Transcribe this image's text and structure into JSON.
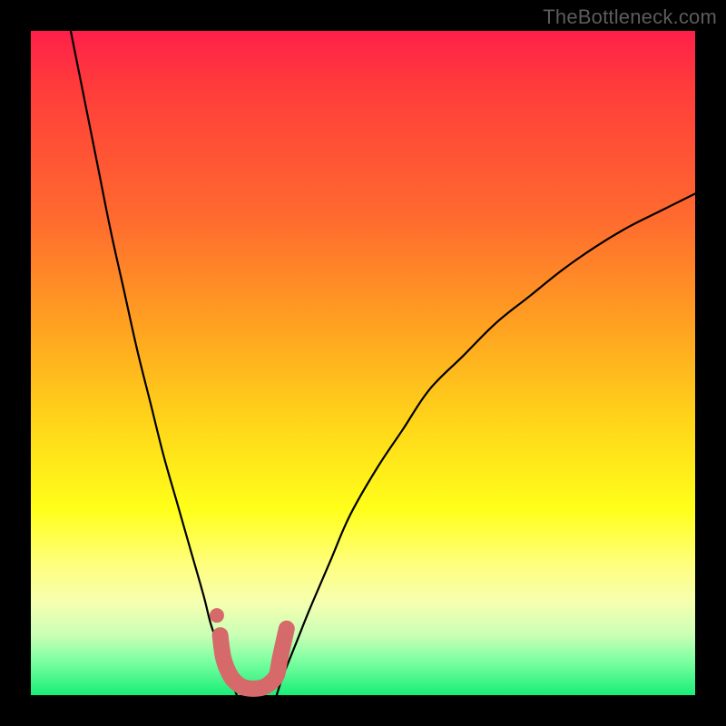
{
  "watermark": "TheBottleneck.com",
  "chart_data": {
    "type": "line",
    "title": "",
    "xlabel": "",
    "ylabel": "",
    "xlim": [
      0,
      100
    ],
    "ylim": [
      0,
      100
    ],
    "grid": false,
    "series": [
      {
        "name": "curve-left",
        "color": "#000000",
        "x": [
          6,
          8,
          10,
          12,
          14,
          16,
          18,
          20,
          22,
          24,
          26,
          27,
          28,
          29,
          30,
          31
        ],
        "y": [
          100,
          90,
          80,
          70,
          61,
          52,
          44,
          36,
          29,
          22,
          15,
          11,
          8,
          5,
          2.5,
          0
        ]
      },
      {
        "name": "curve-right",
        "color": "#000000",
        "x": [
          37,
          38,
          40,
          42,
          45,
          48,
          52,
          56,
          60,
          65,
          70,
          75,
          80,
          85,
          90,
          95,
          100
        ],
        "y": [
          0,
          3,
          8,
          13,
          20,
          27,
          34,
          40,
          46,
          51,
          56,
          60,
          64,
          67.5,
          70.5,
          73,
          75.5
        ]
      },
      {
        "name": "marker-band",
        "color": "#d66a6a",
        "x": [
          28.5,
          29,
          30,
          31,
          32,
          33,
          34,
          35,
          36,
          37,
          37.5,
          38.5
        ],
        "y": [
          9,
          5.5,
          3,
          1.8,
          1.2,
          1,
          1,
          1.2,
          1.8,
          3,
          5.5,
          10
        ]
      },
      {
        "name": "marker-dot",
        "color": "#d66a6a",
        "x": [
          28
        ],
        "y": [
          12
        ]
      }
    ],
    "background_gradient": {
      "top": "#ff1f4a",
      "bottom": "#18ee78"
    }
  }
}
